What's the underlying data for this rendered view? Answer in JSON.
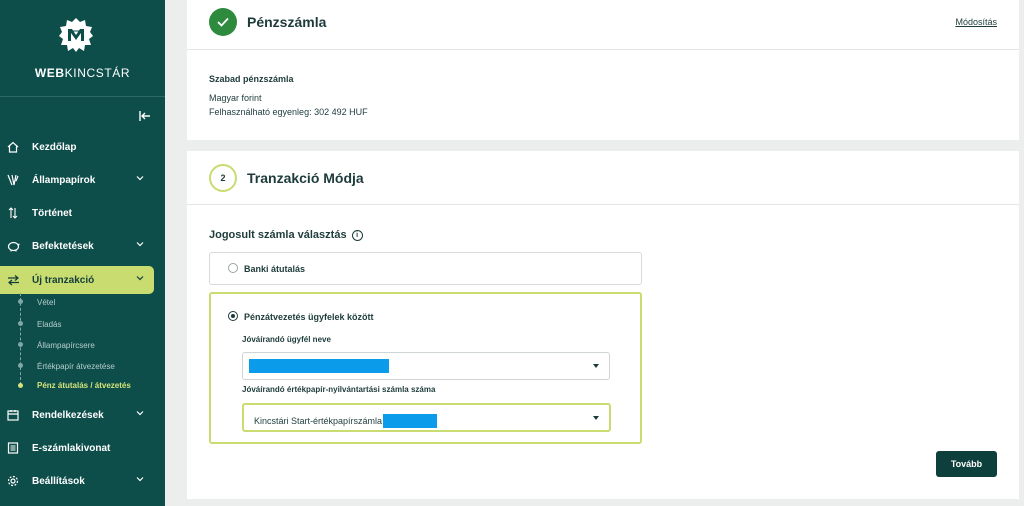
{
  "brand": {
    "bold": "WEB",
    "light": "KINCSTÁR"
  },
  "sidebar": {
    "items": [
      {
        "label": "Kezdőlap",
        "icon": "home-icon"
      },
      {
        "label": "Állampapírok",
        "icon": "wheat-icon",
        "expandable": true
      },
      {
        "label": "Történet",
        "icon": "history-arrows-icon"
      },
      {
        "label": "Befektetések",
        "icon": "piggy-bank-icon",
        "expandable": true
      },
      {
        "label": "Új tranzakció",
        "icon": "swap-arrows-icon",
        "expandable": true,
        "active": true
      },
      {
        "label": "Rendelkezések",
        "icon": "calendar-icon",
        "expandable": true
      },
      {
        "label": "E-számlakivonat",
        "icon": "document-icon"
      },
      {
        "label": "Beállítások",
        "icon": "gear-icon",
        "expandable": true
      }
    ],
    "subitems": [
      {
        "label": "Vétel"
      },
      {
        "label": "Eladás"
      },
      {
        "label": "Állampapírcsere"
      },
      {
        "label": "Értékpapír átvezetése"
      },
      {
        "label": "Pénz átutalás / átvezetés",
        "active": true
      }
    ]
  },
  "step1": {
    "title": "Pénzszámla",
    "modify_label": "Módosítás",
    "account_type": "Szabad pénzszámla",
    "currency": "Magyar forint",
    "balance": "Felhasználható egyenleg: 302 492 HUF"
  },
  "step2": {
    "number": "2",
    "title": "Tranzakció Módja",
    "section_title": "Jogosult számla választás",
    "option1": "Banki átutalás",
    "option2": "Pénzátvezetés ügyfelek között",
    "field1_label": "Jóváírandó ügyfél neve",
    "field2_label": "Jóváírandó értékpapír-nyilvántartási számla száma",
    "field2_value": "Kincstári Start-értékpapírszámla",
    "next_label": "Tovább"
  },
  "colors": {
    "sidebar": "#0d4d4a",
    "accent": "#c9dc6f",
    "success": "#2e8b3e",
    "redaction": "#0a9bea"
  }
}
